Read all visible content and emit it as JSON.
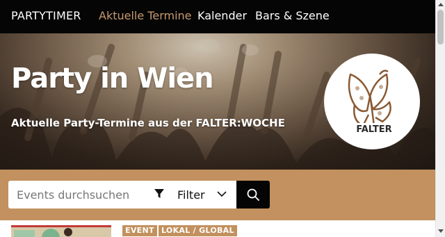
{
  "nav": {
    "brand": "PARTYTIMER",
    "links": [
      {
        "label": "Aktuelle Termine",
        "active": true
      },
      {
        "label": "Kalender",
        "active": false
      },
      {
        "label": "Bars & Szene",
        "active": false
      }
    ],
    "active_color": "#c79a70"
  },
  "hero": {
    "title": "Party in Wien",
    "subtitle": "Aktuelle Party-Termine aus der FALTER:WOCHE",
    "logo": {
      "icon": "falter-logo",
      "text": "FALTER"
    }
  },
  "search": {
    "placeholder": "Events durchsuchen",
    "value": "",
    "filter_label": "Filter",
    "filter_icon": "funnel-icon",
    "dropdown_icon": "chevron-down-icon",
    "submit_icon": "search-icon",
    "band_color": "#c2915f"
  },
  "listing": {
    "tags": [
      "EVENT",
      "LOKAL / GLOBAL"
    ],
    "tag_color": "#c2915f"
  }
}
